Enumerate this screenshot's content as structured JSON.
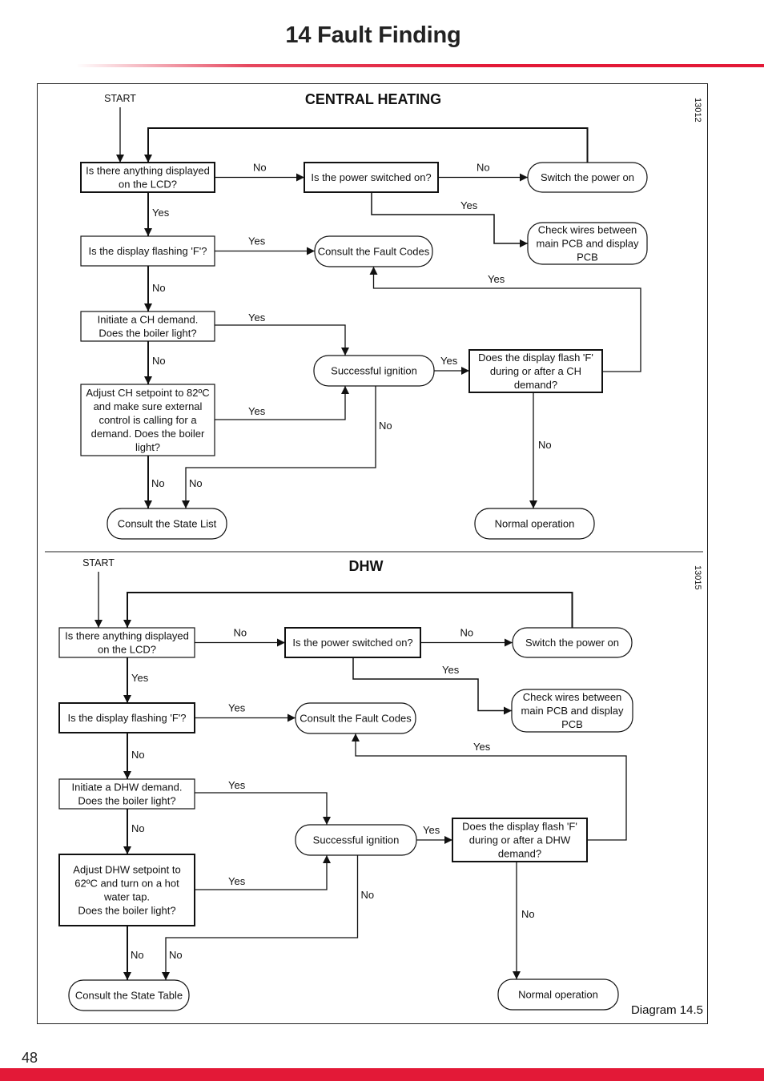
{
  "page": {
    "title": "14  Fault Finding",
    "page_number": "48",
    "diagram_caption": "Diagram 14.5",
    "accent_color": "#e31937"
  },
  "flowcharts": [
    {
      "id": "ch",
      "heading": "CENTRAL HEATING",
      "ref_code": "13012",
      "start_label": "START",
      "nodes": {
        "q_lcd": [
          "Is there anything displayed",
          "on the LCD?"
        ],
        "q_power": [
          "Is the power switched on?"
        ],
        "a_switch": [
          "Switch the power on"
        ],
        "a_wires": [
          "Check wires between",
          "main PCB and display",
          "PCB"
        ],
        "q_flash": [
          "Is the display flashing 'F'?"
        ],
        "a_fault": [
          "Consult the Fault Codes"
        ],
        "q_demand": [
          "Initiate a CH demand.",
          "Does the boiler light?"
        ],
        "a_ignition": [
          "Successful ignition"
        ],
        "q_flash_after": [
          "Does the display flash 'F'",
          "during or after a CH",
          "demand?"
        ],
        "q_adjust": [
          "Adjust CH setpoint to 82ºC",
          "and make sure external",
          "control is calling for a",
          "demand. Does the boiler",
          "light?"
        ],
        "a_state": [
          "Consult the State List"
        ],
        "a_normal": [
          "Normal operation"
        ]
      },
      "edge_labels": {
        "lcd_no": "No",
        "power_no": "No",
        "power_yes": "Yes",
        "lcd_yes": "Yes",
        "flash_yes": "Yes",
        "flash_no": "No",
        "demand_yes": "Yes",
        "demand_no": "No",
        "adjust_yes": "Yes",
        "ignition_yes": "Yes",
        "after_yes": "Yes",
        "ignition_no": "No",
        "adjust_no": "No",
        "after_no": "No"
      }
    },
    {
      "id": "dhw",
      "heading": "DHW",
      "ref_code": "13015",
      "start_label": "START",
      "nodes": {
        "q_lcd": [
          "Is there anything displayed",
          "on the LCD?"
        ],
        "q_power": [
          "Is the power switched on?"
        ],
        "a_switch": [
          "Switch the power on"
        ],
        "a_wires": [
          "Check wires between",
          "main PCB and display",
          "PCB"
        ],
        "q_flash": [
          "Is the display flashing 'F'?"
        ],
        "a_fault": [
          "Consult the Fault Codes"
        ],
        "q_demand": [
          "Initiate a DHW demand.",
          "Does the boiler light?"
        ],
        "a_ignition": [
          "Successful ignition"
        ],
        "q_flash_after": [
          "Does the display flash 'F'",
          "during or after a DHW",
          "demand?"
        ],
        "q_adjust": [
          "Adjust DHW setpoint to",
          "62ºC and turn on a hot",
          "water tap.",
          "Does the boiler light?"
        ],
        "a_state": [
          "Consult the State Table"
        ],
        "a_normal": [
          "Normal operation"
        ]
      },
      "edge_labels": {
        "lcd_no": "No",
        "power_no": "No",
        "power_yes": "Yes",
        "lcd_yes": "Yes",
        "flash_yes": "Yes",
        "flash_no": "No",
        "demand_yes": "Yes",
        "demand_no": "No",
        "adjust_yes": "Yes",
        "ignition_yes": "Yes",
        "after_yes": "Yes",
        "ignition_no": "No",
        "adjust_no": "No",
        "after_no": "No"
      }
    }
  ]
}
